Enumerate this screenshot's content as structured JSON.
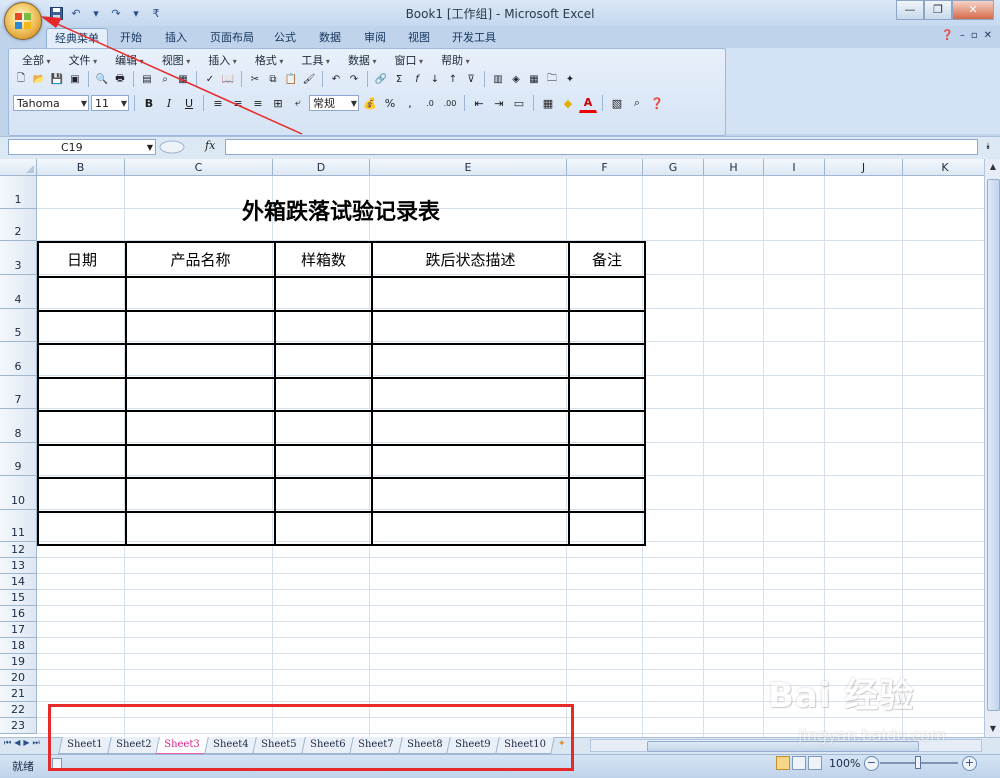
{
  "window": {
    "title": "Book1  [工作组] - Microsoft Excel",
    "buttons": [
      "0",
      "1",
      "r"
    ]
  },
  "ribbon_tabs": [
    "经典菜单",
    "开始",
    "插入",
    "页面布局",
    "公式",
    "数据",
    "审阅",
    "视图",
    "开发工具"
  ],
  "ribbon_right": [
    "?",
    "-",
    "▫",
    "x"
  ],
  "classic_menu": [
    "全部",
    "文件",
    "编辑",
    "视图",
    "插入",
    "格式",
    "工具",
    "数据",
    "窗口",
    "帮助"
  ],
  "font": {
    "name": "Tahoma",
    "size": "11"
  },
  "number_format": "常规",
  "formula_bar": {
    "name_box": "C19",
    "fx": "fx",
    "value": ""
  },
  "columns": [
    "B",
    "C",
    "D",
    "E",
    "F",
    "G",
    "H",
    "I",
    "J",
    "K"
  ],
  "rows": [
    "1",
    "2",
    "3",
    "4",
    "5",
    "6",
    "7",
    "8",
    "9",
    "10",
    "11",
    "12",
    "13",
    "14",
    "15",
    "16",
    "17",
    "18",
    "19",
    "20",
    "21",
    "22",
    "23"
  ],
  "sheet": {
    "title": "外箱跌落试验记录表",
    "headers": [
      "日期",
      "产品名称",
      "样箱数",
      "跌后状态描述",
      "备注"
    ],
    "empty_rows": 8
  },
  "sheet_tabs": [
    "Sheet1",
    "Sheet2",
    "Sheet3",
    "Sheet4",
    "Sheet5",
    "Sheet6",
    "Sheet7",
    "Sheet8",
    "Sheet9",
    "Sheet10"
  ],
  "active_sheet": "Sheet3",
  "status": {
    "ready": "就绪",
    "zoom": "100%"
  },
  "watermark": {
    "logo": "Bai 经验",
    "url": "jingyan.baidu.com"
  },
  "colors": {
    "annotation": "#e62a2a",
    "active_tab_text": "#d4238a"
  }
}
